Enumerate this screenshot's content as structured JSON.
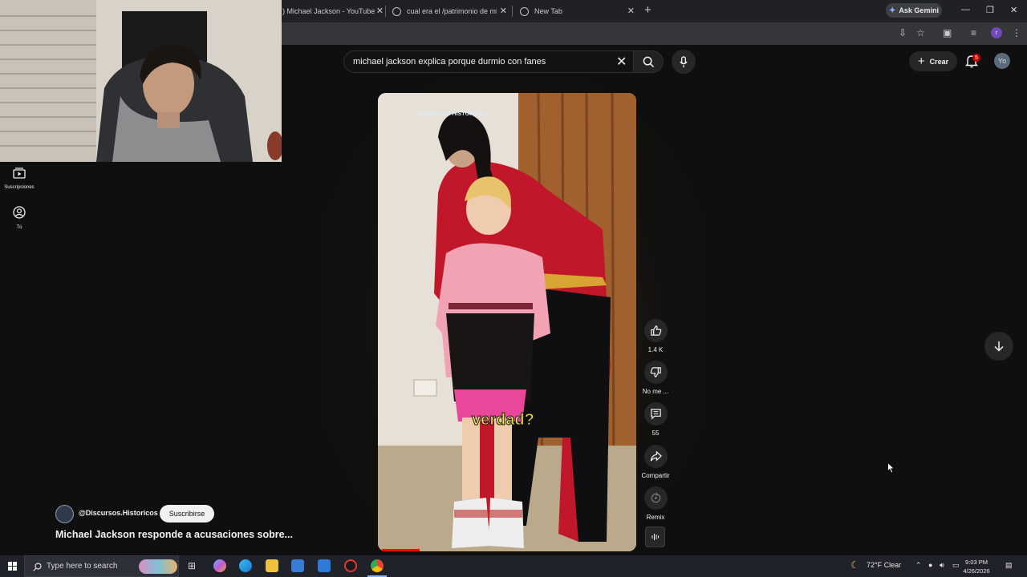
{
  "browser": {
    "tabs": [
      {
        "title": ") Michael Jackson - YouTube"
      },
      {
        "title": "cual era el /patrimonio de mich"
      },
      {
        "title": "New Tab"
      }
    ],
    "gemini_label": "Ask Gemini"
  },
  "header": {
    "search_query": "michael jackson explica porque durmio con fanes",
    "create_label": "Crear",
    "notification_count": "5",
    "avatar_initials": "Yo"
  },
  "sidebar": {
    "items": [
      {
        "label": "Suscripciones",
        "icon": "subscriptions-icon"
      },
      {
        "label": "Tú",
        "icon": "you-icon"
      }
    ]
  },
  "video": {
    "watermark": "DISCURSOS HISTÓRICOS",
    "caption": "verdad?",
    "progress_fraction": 0.15
  },
  "actions": {
    "like_count": "1.4 K",
    "dislike_label": "No me ...",
    "comments_count": "55",
    "share_label": "Compartir",
    "remix_label": "Remix"
  },
  "channel": {
    "handle": "@Discursos.Historicos",
    "subscribe_label": "Suscribirse",
    "video_title": "Michael Jackson responde a acusaciones sobre..."
  },
  "taskbar": {
    "search_placeholder": "Type here to search",
    "weather": "72°F  Clear",
    "time": "9:03 PM",
    "date": "4/26/2026"
  },
  "colors": {
    "background": "#0f0f0f",
    "accent_red": "#ff0000",
    "caption_yellow": "#f5e84a"
  }
}
